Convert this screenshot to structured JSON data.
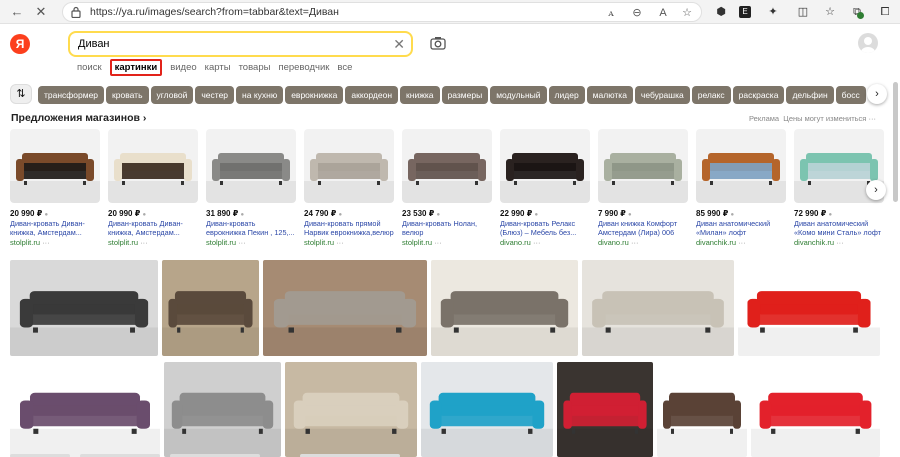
{
  "browser": {
    "url": "https://ya.ru/images/search?from=tabbar&text=Диван"
  },
  "header": {
    "logo_letter": "Я",
    "query": "Диван"
  },
  "tabs": [
    "поиск",
    "картинки",
    "видео",
    "карты",
    "товары",
    "переводчик",
    "все"
  ],
  "active_tab": "картинки",
  "chips": [
    "трансформер",
    "кровать",
    "угловой",
    "честер",
    "на кухню",
    "еврокнижка",
    "аккордеон",
    "книжка",
    "размеры",
    "модульный",
    "лидер",
    "малютка",
    "чебурашка",
    "релакс",
    "раскраска",
    "дельфин",
    "босс"
  ],
  "shop": {
    "title": "Предложения магазинов",
    "ads_label": "Реклама",
    "disclaimer": "Цены могут измениться",
    "products": [
      {
        "price": "20 990 ₽",
        "name": "Диван-кровать Диван-книжка, Амстердам...",
        "shop": "stolplit.ru",
        "color": "#7a4a2a",
        "color2": "#1e1a18"
      },
      {
        "price": "20 990 ₽",
        "name": "Диван-кровать Диван-книжка, Амстердам...",
        "shop": "stolplit.ru",
        "color": "#e9dfcb",
        "color2": "#3a2a1e"
      },
      {
        "price": "31 890 ₽",
        "name": "Диван-кровать еврокнижка Пекин , 125,...",
        "shop": "stolplit.ru",
        "color": "#8a8a88",
        "color2": "#6f6f6d"
      },
      {
        "price": "24 790 ₽",
        "name": "Диван-кровать прямой Нарвик еврокнижка,велюр",
        "shop": "stolplit.ru",
        "color": "#bfb8ae",
        "color2": "#a9a298"
      },
      {
        "price": "23 530 ₽",
        "name": "Диван-кровать Нолан, велюр",
        "shop": "stolplit.ru",
        "color": "#776660",
        "color2": "#5f514c"
      },
      {
        "price": "22 990 ₽",
        "name": "Диван-кровать Релакс (Блюз) – Мебель без...",
        "shop": "divano.ru",
        "color": "#2a2220",
        "color2": "#1a1514"
      },
      {
        "price": "7 990 ₽",
        "name": "Диван книжка Комфорт Амстердам (Лира) 006",
        "shop": "divano.ru",
        "color": "#a9b0a0",
        "color2": "#8d9585"
      },
      {
        "price": "85 990 ₽",
        "name": "Диван анатомический «Милан» лофт",
        "shop": "divanchik.ru",
        "color": "#b5652b",
        "color2": "#7fa2c2"
      },
      {
        "price": "72 990 ₽",
        "name": "Диван анатомический «Комо мини Сталь» лофт",
        "shop": "divanchik.ru",
        "color": "#7cc4b0",
        "color2": "#b9d3d6"
      }
    ]
  },
  "grid_images": [
    {
      "color": "#d9d9d9",
      "sofa": "#3a3a3a"
    },
    {
      "color": "#b7a58a",
      "sofa": "#5a4a3c"
    },
    {
      "color": "#a68b73",
      "sofa": "#a29a90"
    },
    {
      "color": "#ece8e0",
      "sofa": "#7a7269"
    },
    {
      "color": "#e6e3dd",
      "sofa": "#c8c2b6"
    },
    {
      "color": "#ffffff",
      "sofa": "#e0201b"
    },
    {
      "color": "#ffffff",
      "sofa": "#6a4d6d"
    },
    {
      "color": "#cfcfcf",
      "sofa": "#8d8d8d"
    },
    {
      "color": "#c7b9a3",
      "sofa": "#d9cfbd"
    },
    {
      "color": "#e4e7ea",
      "sofa": "#1fa2c8"
    },
    {
      "color": "#3a3430",
      "sofa": "#d01f33"
    },
    {
      "color": "#ffffff",
      "sofa": "#5a4236"
    },
    {
      "color": "#ffffff",
      "sofa": "#e3212b"
    },
    {
      "color": "#d5d5d3",
      "sofa": "#3c3c3c"
    }
  ]
}
